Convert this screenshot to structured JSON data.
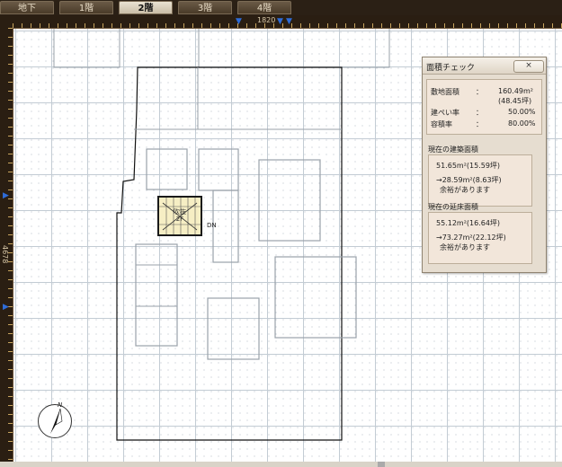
{
  "tabs": [
    {
      "label": "地下",
      "active": false
    },
    {
      "label": "1階",
      "active": false
    },
    {
      "label": "2階",
      "active": true
    },
    {
      "label": "3階",
      "active": false
    },
    {
      "label": "4階",
      "active": false
    }
  ],
  "rulers": {
    "top_label": "1820",
    "left_label": "4678"
  },
  "plan": {
    "stair_label_1": "吹抜",
    "stair_label_2": "2F",
    "dn_label": "DN",
    "compass_label": "N"
  },
  "area_panel": {
    "title": "面積チェック",
    "close_label": "×",
    "site_area_label": "敷地面積",
    "site_area_value": "160.49m²",
    "site_area_tsubo": "(48.45坪)",
    "coverage_label": "建ぺい率",
    "coverage_value": "50.00%",
    "far_label": "容積率",
    "far_value": "80.00%",
    "colon": "：",
    "building_area_title": "現在の建築面積",
    "building_area_value": "51.65m²(15.59坪)",
    "building_area_remaining": "→28.59m²(8.63坪)",
    "building_area_note": "余裕があります",
    "floor_area_title": "現在の延床面積",
    "floor_area_value": "55.12m²(16.64坪)",
    "floor_area_remaining": "→73.27m²(22.12坪)",
    "floor_area_note": "余裕があります"
  },
  "colors": {
    "background": "#3a2a18",
    "tab_active": "#e9e2d2",
    "marker_blue": "#2e6cd8",
    "panel_bg": "#e6ddd0",
    "stair_fill": "#f6eec4"
  }
}
